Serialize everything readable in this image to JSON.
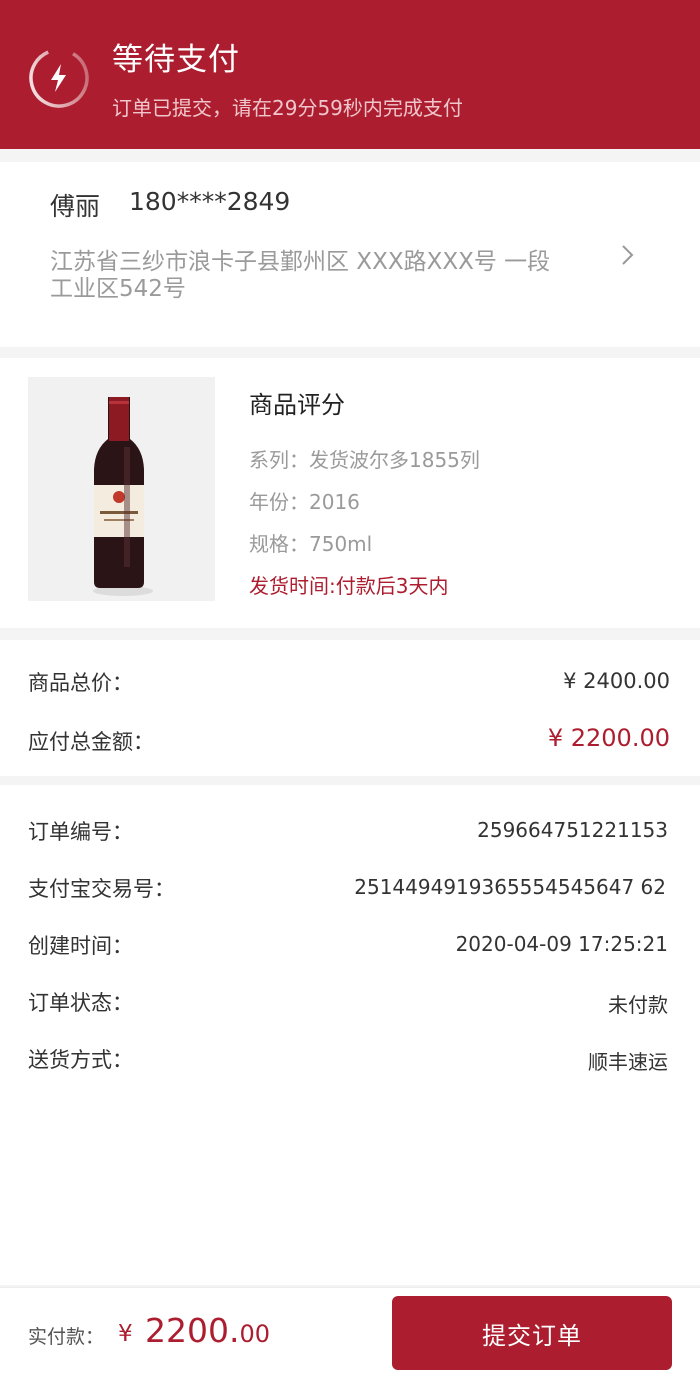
{
  "header": {
    "title": "等待支付",
    "subtitle": "订单已提交，请在29分59秒内完成支付",
    "icon": "lightning-icon"
  },
  "address": {
    "name": "傅丽",
    "phone": "180****2849",
    "detail": "江苏省三纱市浪卡子县鄞州区 XXX路XXX号 一段工业区542号",
    "icon": "chevron-right-icon"
  },
  "product": {
    "name": "商品评分",
    "series": "系列：发货波尔多1855列",
    "year": "年份：2016",
    "spec": "规格：750ml",
    "shipping": "发货时间:付款后3天内",
    "image": "wine-bottle-image"
  },
  "price": {
    "total_label": "商品总价：",
    "total_value": "¥ 2400.00",
    "pay_label": "应付总金额：",
    "pay_value": "¥ 2200.00"
  },
  "order_info": {
    "rows": [
      {
        "label": "订单编号：",
        "value": "259664751221153"
      },
      {
        "label": "支付宝交易号：",
        "value": "2514494919365554545647 62"
      },
      {
        "label": "创建时间：",
        "value": "2020-04-09 17:25:21"
      },
      {
        "label": "订单状态：",
        "value": "未付款"
      },
      {
        "label": "送货方式：",
        "value": "顺丰速运"
      }
    ]
  },
  "bottom_bar": {
    "label": "实付款：",
    "currency": "¥",
    "amount_int": "2200.",
    "amount_dec": "00",
    "submit_label": "提交订单"
  },
  "colors": {
    "brand": "#ac1e2f",
    "muted_text": "#9a9a9a",
    "page_bg": "#f4f4f4"
  }
}
